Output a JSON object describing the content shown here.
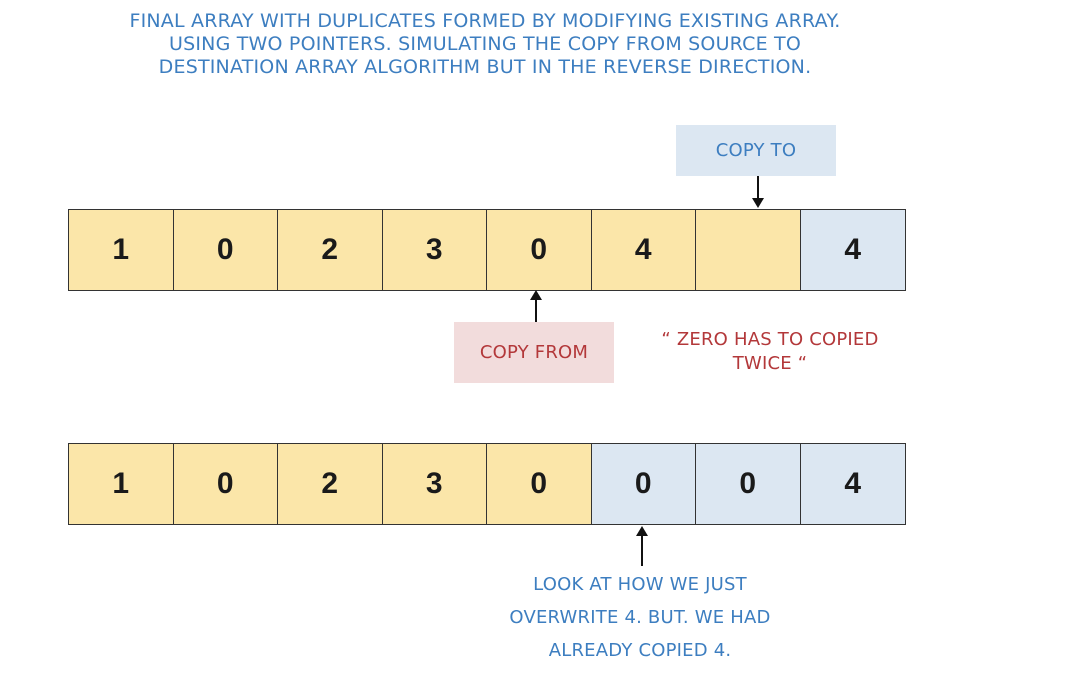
{
  "title": {
    "lines": [
      "FINAL ARRAY WITH DUPLICATES FORMED BY MODIFYING EXISTING ARRAY.",
      "USING TWO POINTERS.  SIMULATING THE COPY FROM SOURCE TO",
      "DESTINATION ARRAY ALGORITHM BUT IN THE REVERSE DIRECTION."
    ]
  },
  "colors": {
    "title": "#3d7ec0",
    "note": "#b3383a",
    "copy_to_bg": "#dce7f2",
    "copy_from_bg": "#f2dcdc",
    "yellow_cell": "#fbe6a9",
    "blue_cell": "#dce7f2"
  },
  "top_array": [
    "1",
    "0",
    "2",
    "3",
    "0",
    "4",
    "",
    "4"
  ],
  "bottom_array": [
    "1",
    "0",
    "2",
    "3",
    "0",
    "0",
    "0",
    "4"
  ],
  "labels": {
    "copy_to": "COPY TO",
    "copy_from": "COPY FROM"
  },
  "zero_note": [
    "“ ZERO HAS TO COPIED",
    "TWICE “"
  ],
  "bottom_note": [
    "LOOK AT HOW WE JUST",
    "OVERWRITE 4. BUT. WE HAD",
    "ALREADY COPIED 4."
  ]
}
